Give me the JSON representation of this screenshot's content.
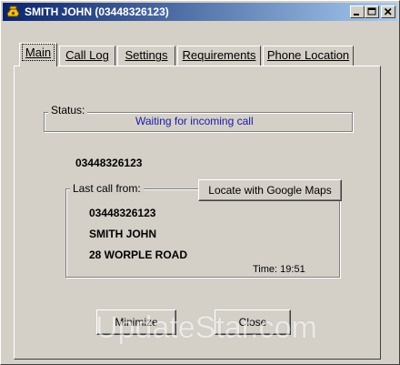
{
  "window": {
    "title": "SMITH JOHN (03448326123)"
  },
  "tabs": [
    {
      "label": "Main",
      "active": true
    },
    {
      "label": "Call Log",
      "active": false
    },
    {
      "label": "Settings",
      "active": false
    },
    {
      "label": "Requirements",
      "active": false
    },
    {
      "label": "Phone Location",
      "active": false
    }
  ],
  "status": {
    "label": "Status:",
    "text": "Waiting for incoming call",
    "text_color": "#1a1aa8"
  },
  "current_number": "03448326123",
  "last_call": {
    "label": "Last call from:",
    "number": "03448326123",
    "name": "SMITH JOHN",
    "address": "28 WORPLE ROAD",
    "time_label": "Time:",
    "time_value": "19:51"
  },
  "buttons": {
    "locate": "Locate with Google Maps",
    "minimize": "Minimize",
    "close": "Close"
  },
  "watermark": "UpdateStar.com",
  "colors": {
    "titlebar_start": "#0a246a",
    "titlebar_end": "#a6caf0",
    "face": "#d4d0c8"
  }
}
